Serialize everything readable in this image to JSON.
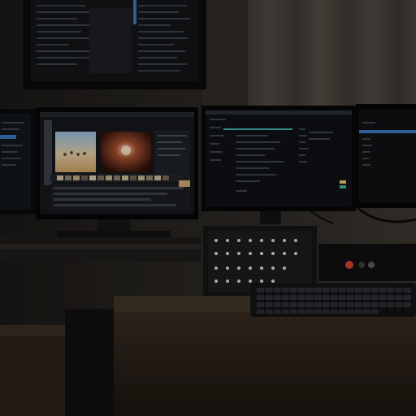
{
  "scene": {
    "description_colors": {
      "wall": "#2a2724",
      "curtain": "#4a433d",
      "desk": "#2b2219",
      "screen_bg": "#0d0f12",
      "accent_blue": "#3a6fb8",
      "accent_teal": "#3fa7a0",
      "accent_red": "#c8412e"
    },
    "objects": {
      "top_monitor": "top-monitor",
      "left_edge_monitor": "left-edge-monitor",
      "video_editor_monitor": "video-editor-monitor",
      "code_monitor": "code-monitor",
      "right_monitor": "right-monitor",
      "mixer": "audio-mixer",
      "keyboard": "keyboard"
    }
  }
}
